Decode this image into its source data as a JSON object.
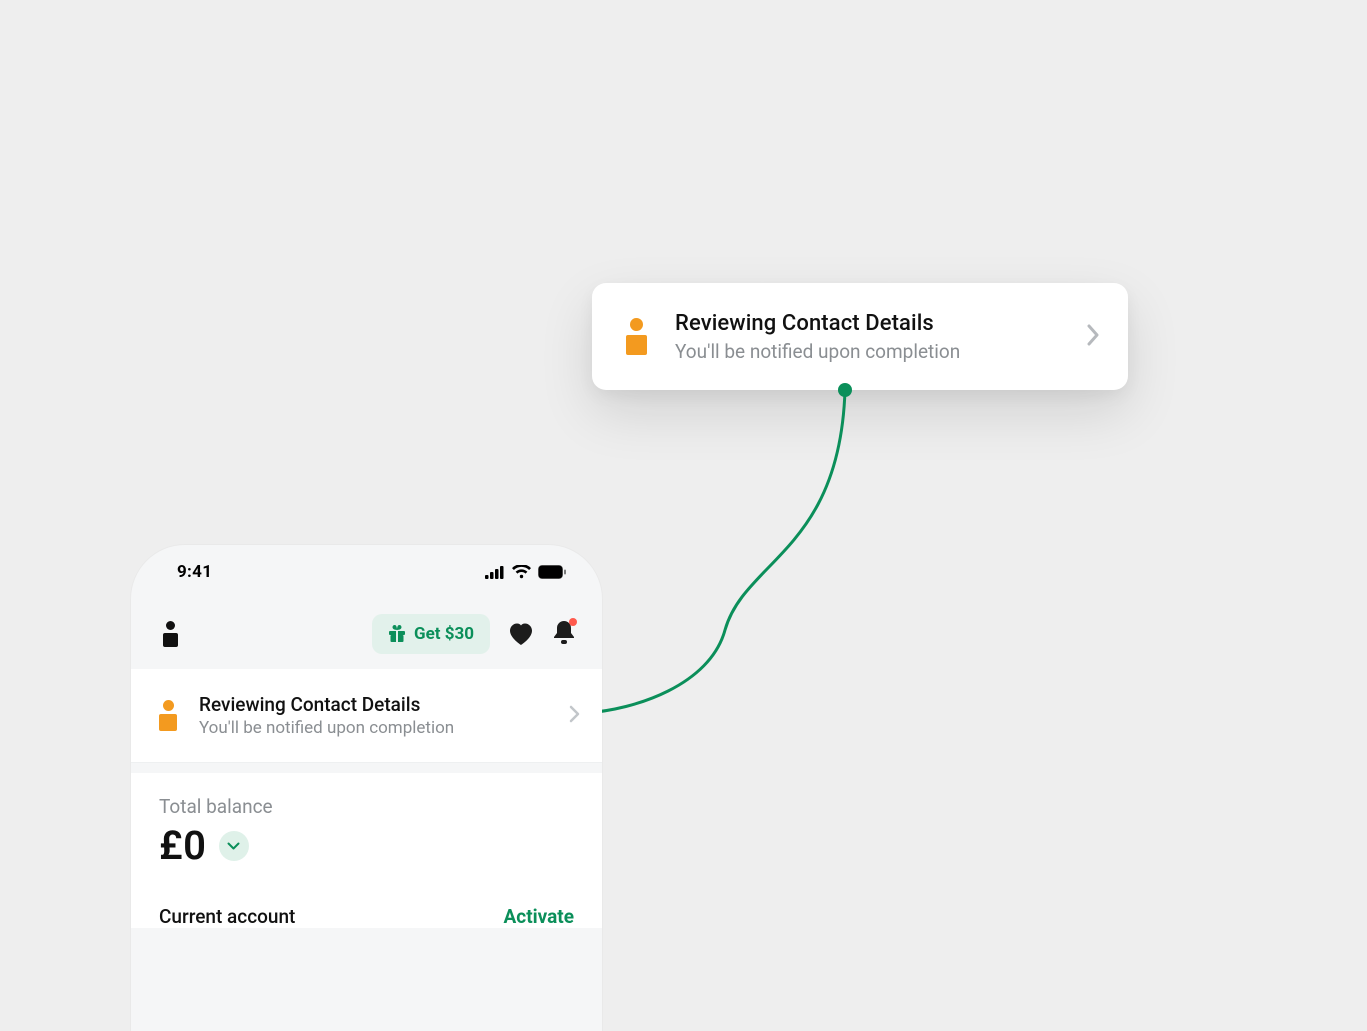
{
  "callout": {
    "title": "Reviewing Contact Details",
    "subtitle": "You'll be notified upon completion"
  },
  "phone": {
    "status": {
      "time": "9:41"
    },
    "appbar": {
      "promo_label": "Get $30"
    },
    "notice": {
      "title": "Reviewing Contact Details",
      "subtitle": "You'll be notified upon completion"
    },
    "balance": {
      "label": "Total balance",
      "amount": "£0"
    },
    "account": {
      "name": "Current account",
      "action": "Activate"
    }
  },
  "colors": {
    "accent_green": "#0b8f5a",
    "accent_orange": "#f39a1f",
    "notif_dot": "#ff5a4d"
  }
}
